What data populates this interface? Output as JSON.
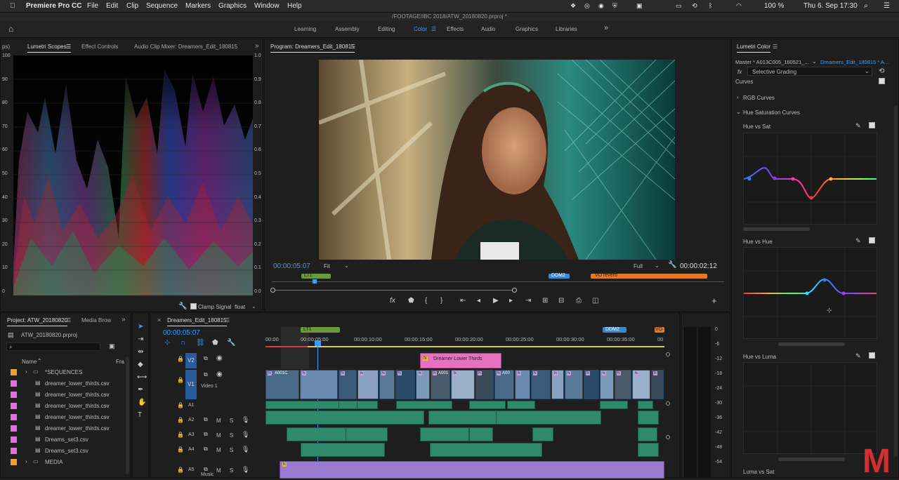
{
  "menubar": {
    "apple": "",
    "app": "Premiere Pro CC",
    "items": [
      "File",
      "Edit",
      "Clip",
      "Sequence",
      "Markers",
      "Graphics",
      "Window",
      "Help"
    ],
    "battery": "100 %",
    "clock": "Thu 6. Sep  17:30"
  },
  "window_title": "/FOOTAGE/IBC 2018/ATW_20180820.prproj *",
  "workspaces": {
    "items": [
      "Learning",
      "Assembly",
      "Editing",
      "Color",
      "Effects",
      "Audio",
      "Graphics",
      "Libraries"
    ],
    "active": "Color",
    "more": "»"
  },
  "scopes_panel": {
    "partial_tab": "ps)",
    "tabs": [
      "Lumetri Scopes",
      "Effect Controls",
      "Audio Clip Mixer: Dreamers_Edit_180815"
    ],
    "left_scale": [
      "100",
      "90",
      "80",
      "70",
      "60",
      "50",
      "40",
      "30",
      "20",
      "10",
      "0"
    ],
    "right_scale": [
      "1.0",
      "0.9",
      "0.8",
      "0.7",
      "0.6",
      "0.5",
      "0.4",
      "0.3",
      "0.2",
      "0.1",
      "0.0"
    ],
    "clamp_label": "Clamp Signal",
    "float_label": "float"
  },
  "program_monitor": {
    "tab": "Program: Dreamers_Edit_180815",
    "timecode": "00:00:05:07",
    "fit": "Fit",
    "full": "Full",
    "duration": "00:00:02:12",
    "markers": [
      "LT1",
      "DDM2",
      "VO reverb"
    ]
  },
  "lumetri_color": {
    "tab": "Lumetri Color",
    "master": "Master * A013C005_160521_...",
    "sequence": "Dreamers_Edit_180815 * A...",
    "fx": "fx",
    "effect": "Selective Grading",
    "curves_label": "Curves",
    "rgb_curves": "RGB Curves",
    "hue_sat_curves": "Hue Saturation Curves",
    "hue_vs_sat": "Hue vs Sat",
    "hue_vs_hue": "Hue vs Hue",
    "hue_vs_luma": "Hue vs Luma",
    "luma_vs_sat": "Luma vs Sat"
  },
  "project_panel": {
    "tab": "Project: ATW_20180820",
    "tab2": "Media Brow",
    "file": "ATW_20180820.prproj",
    "col_name": "Name",
    "col_fr": "Fra",
    "items": [
      {
        "name": "*SEQUENCES",
        "color": "#f0a030",
        "folder": true
      },
      {
        "name": "dreamer_lower_thirds.csv",
        "color": "#e070d8",
        "folder": false
      },
      {
        "name": "dreamer_lower_thirds.csv",
        "color": "#e070d8",
        "folder": false
      },
      {
        "name": "dreamer_lower_thirds.csv",
        "color": "#e070d8",
        "folder": false
      },
      {
        "name": "dreamer_lower_thirds.csv",
        "color": "#e070d8",
        "folder": false
      },
      {
        "name": "dreamer_lower_thirds.csv",
        "color": "#e070d8",
        "folder": false
      },
      {
        "name": "Dreams_set3.csv",
        "color": "#e070d8",
        "folder": false
      },
      {
        "name": "Dreams_set3.csv",
        "color": "#e070d8",
        "folder": false
      },
      {
        "name": "MEDIA",
        "color": "#f0a030",
        "folder": true
      }
    ]
  },
  "timeline": {
    "tab": "Dreamers_Edit_180815",
    "timecode": "00:00:05:07",
    "ruler": [
      "00:00",
      "00:00:05:00",
      "00:00:10:00",
      "00:00:15:00",
      "00:00:20:00",
      "00:00:25:00",
      "00:00:30:00",
      "00:00:35:00",
      "00"
    ],
    "markers": [
      "LT1",
      "DDM2",
      "VO"
    ],
    "tracks": {
      "v2": "V2",
      "v1": "V1",
      "video1": "Video 1",
      "a1": "A1",
      "a2": "A2",
      "a3": "A3",
      "a4": "A4",
      "a5": "A5",
      "music": "Music",
      "m": "M",
      "s": "S"
    },
    "title_clip": "Dreamer Lower Thirds",
    "clip_labels": [
      "A001C",
      "A001",
      "A00"
    ],
    "meter_scale": [
      "0",
      "-6",
      "-12",
      "-18",
      "-24",
      "-30",
      "-36",
      "-42",
      "-48",
      "-54"
    ]
  },
  "watermark": "M"
}
